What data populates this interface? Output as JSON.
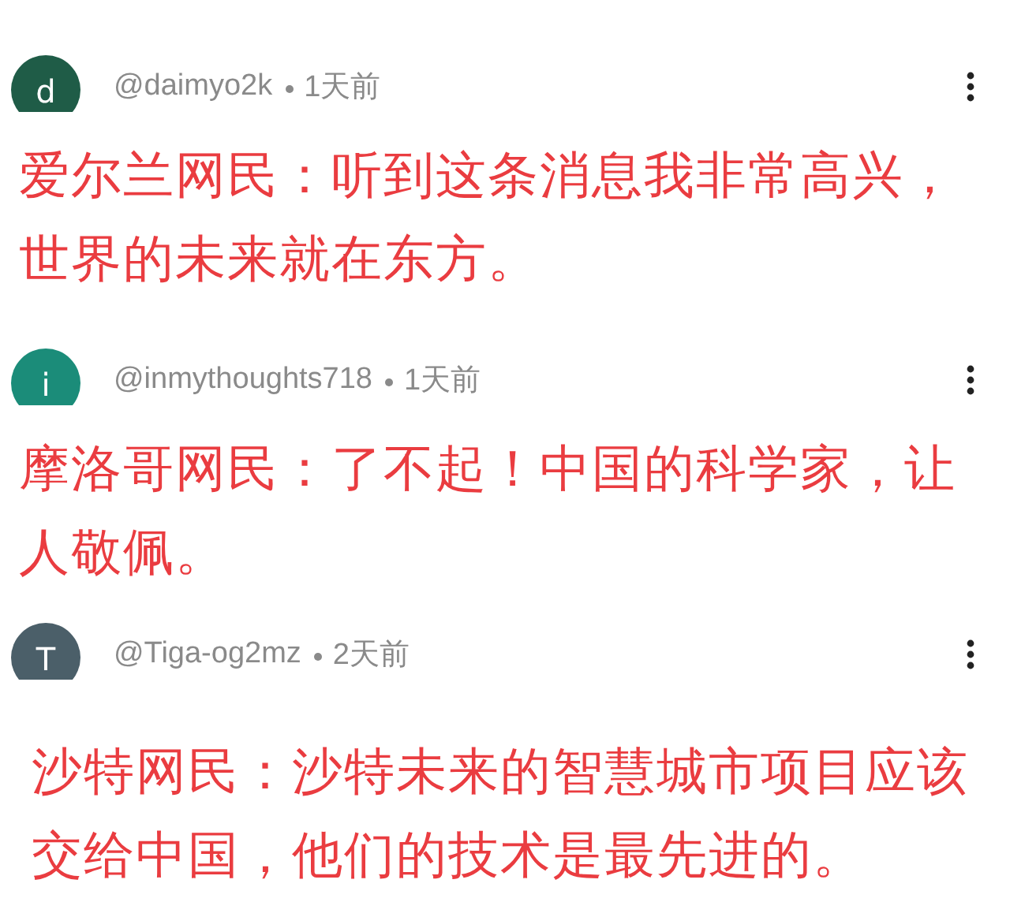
{
  "comments": [
    {
      "avatar_letter": "d",
      "color": "#1f5c47",
      "handle": "@daimyo2k",
      "time": "1天前",
      "text": "爱尔兰网民：听到这条消息我非常高兴，世界的未来就在东方。"
    },
    {
      "avatar_letter": "i",
      "color": "#1b8c79",
      "handle": "@inmythoughts718",
      "time": "1天前",
      "text": "摩洛哥网民：了不起！中国的科学家，让人敬佩。"
    },
    {
      "avatar_letter": "T",
      "color": "#4b5f69",
      "handle": "@Tiga-og2mz",
      "time": "2天前",
      "text": "沙特网民：沙特未来的智慧城市项目应该交给中国，他们的技术是最先进的。"
    }
  ]
}
